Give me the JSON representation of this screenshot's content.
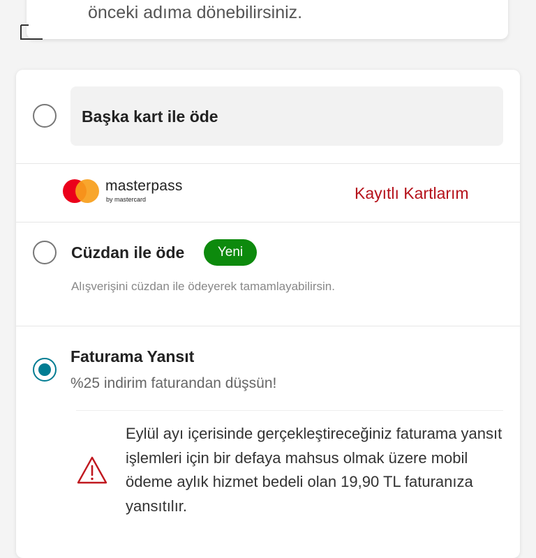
{
  "top_card": {
    "text": "önceki adıma dönebilirsiniz."
  },
  "payment_options": {
    "other_card": {
      "label": "Başka kart ile öde",
      "selected": false
    },
    "masterpass": {
      "logo_text": "masterpass",
      "logo_sub": "by mastercard",
      "saved_cards_link": "Kayıtlı Kartlarım"
    },
    "wallet": {
      "label": "Cüzdan ile öde",
      "badge": "Yeni",
      "description": "Alışverişini cüzdan ile ödeyerek tamamlayabilirsin.",
      "selected": false
    },
    "invoice": {
      "label": "Faturama Yansıt",
      "subtitle": "%25 indirim faturandan düşsün!",
      "selected": true
    }
  },
  "notice": {
    "icon": "warning-triangle-icon",
    "text": "Eylül ayı içerisinde gerçekleştireceğiniz faturama yansıt işlemleri için bir defaya mahsus olmak üzere mobil ödeme aylık hizmet bedeli olan 19,90 TL faturanıza yansıtılır."
  },
  "colors": {
    "accent_teal": "#007c92",
    "brand_red": "#b5121b",
    "badge_green": "#0d8a0d",
    "mastercard_red": "#eb001b",
    "mastercard_orange": "#f79e1b"
  }
}
